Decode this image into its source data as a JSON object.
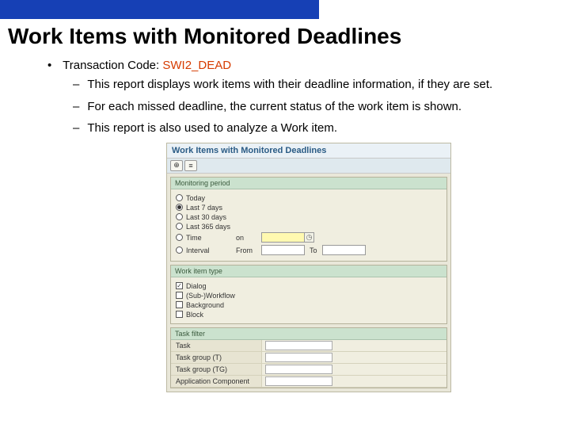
{
  "title": "Work Items with Monitored Deadlines",
  "tcode_label": "Transaction Code: ",
  "tcode_value": "SWI2_DEAD",
  "bullets": [
    "This report displays work items with their deadline information, if they are set.",
    "For each missed deadline, the current status of the work item is shown.",
    "This report is also used to analyze a Work item."
  ],
  "sap": {
    "title": "Work Items with Monitored Deadlines",
    "toolbar": {
      "b1": "⊕",
      "b2": "≡"
    },
    "period": {
      "head": "Monitoring period",
      "today": "Today",
      "last7": "Last 7 days",
      "last30": "Last 30 days",
      "last365": "Last 365 days",
      "time": "Time",
      "interval": "Interval",
      "on": "on",
      "from": "From",
      "to": "To"
    },
    "type": {
      "head": "Work item type",
      "dialog": "Dialog",
      "subwf": "(Sub-)Workflow",
      "bg": "Background",
      "block": "Block"
    },
    "filter": {
      "head": "Task filter",
      "task": "Task",
      "tg_t": "Task group (T)",
      "tg_tg": "Task group (TG)",
      "appcomp": "Application Component"
    }
  }
}
